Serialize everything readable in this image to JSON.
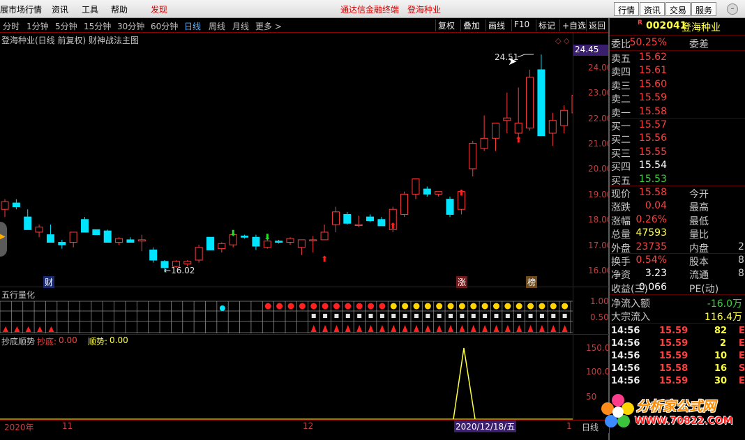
{
  "menubar": {
    "items": [
      "展市场行情",
      "资讯",
      "工具",
      "帮助"
    ],
    "discover": "发现",
    "center_title": "通达信金融终端",
    "center_stock": "登海种业",
    "right_buttons": [
      "行情",
      "资讯",
      "交易",
      "服务"
    ]
  },
  "periods": [
    "分时",
    "1分钟",
    "5分钟",
    "15分钟",
    "30分钟",
    "60分钟",
    "日线",
    "周线",
    "月线",
    "更多 >"
  ],
  "toolbar": [
    "复权",
    "叠加",
    "画线",
    "F10",
    "标记",
    "+自选",
    "返回"
  ],
  "chart_title": "登海种业(日线 前复权) 财神战法主图",
  "price_axis": [
    "24.00",
    "23.00",
    "22.00",
    "21.00",
    "20.00",
    "19.00",
    "18.00",
    "17.00",
    "16.00"
  ],
  "current_price_tag": "24.45",
  "high_label": "24.51",
  "low_label": "16.02",
  "markers": {
    "cai": "财",
    "zhang": "涨",
    "bang": "榜"
  },
  "indicator1": {
    "title": "五行量化",
    "axis": [
      "1.00",
      "0.50"
    ]
  },
  "indicator2": {
    "title": "抄底顺势",
    "chaodi_label": "抄底:",
    "chaodi_value": "0.00",
    "shunshi_label": "顺势:",
    "shunshi_value": "0.00",
    "axis": [
      "150.0",
      "100.0",
      "50"
    ]
  },
  "date_axis": {
    "year": "2020年",
    "m11": "11",
    "m12": "12",
    "cursor": "2020/12/18/五",
    "m1": "1",
    "period": "日线"
  },
  "quote": {
    "code": "002041",
    "name": "登海种业",
    "weibi_label": "委比",
    "weibi_value": "50.25%",
    "weicha_label": "委差",
    "asks": [
      {
        "label": "卖五",
        "price": "15.62"
      },
      {
        "label": "卖四",
        "price": "15.61"
      },
      {
        "label": "卖三",
        "price": "15.60"
      },
      {
        "label": "卖二",
        "price": "15.59"
      },
      {
        "label": "卖一",
        "price": "15.58"
      }
    ],
    "bids": [
      {
        "label": "买一",
        "price": "15.57"
      },
      {
        "label": "买二",
        "price": "15.56"
      },
      {
        "label": "买三",
        "price": "15.55"
      },
      {
        "label": "买四",
        "price": "15.54"
      },
      {
        "label": "买五",
        "price": "15.53"
      }
    ],
    "stats": [
      {
        "label": "现价",
        "value": "15.58",
        "label2": "今开"
      },
      {
        "label": "涨跌",
        "value": "0.04",
        "label2": "最高"
      },
      {
        "label": "涨幅",
        "value": "0.26%",
        "label2": "最低"
      },
      {
        "label": "总量",
        "value": "47593",
        "label2": "量比"
      },
      {
        "label": "外盘",
        "value": "23735",
        "label2": "内盘",
        "value2": "2"
      }
    ],
    "stats2": [
      {
        "label": "换手",
        "value": "0.54%",
        "label2": "股本",
        "value2": "8"
      },
      {
        "label": "净资",
        "value": "3.23",
        "label2": "流通",
        "value2": "8"
      },
      {
        "label": "收益(三)",
        "value": "0.066",
        "label2": "PE(动)"
      }
    ],
    "flow": [
      {
        "label": "净流入额",
        "value": "-16.0万"
      },
      {
        "label": "大宗流入",
        "value": "116.4万"
      }
    ],
    "ticks": [
      {
        "time": "14:56",
        "price": "15.59",
        "vol": "82",
        "bs": "E"
      },
      {
        "time": "14:56",
        "price": "15.59",
        "vol": "2",
        "bs": "E"
      },
      {
        "time": "14:56",
        "price": "15.59",
        "vol": "10",
        "bs": "E"
      },
      {
        "time": "14:56",
        "price": "15.58",
        "vol": "16",
        "bs": "S"
      },
      {
        "time": "14:56",
        "price": "15.59",
        "vol": "30",
        "bs": "E"
      }
    ]
  },
  "watermark": {
    "title": "分析家公式网",
    "url": "WWW.70822.COM"
  },
  "colors": {
    "up": "#ff3c3c",
    "down": "#00e5ff",
    "axis": "#8b0000",
    "bg": "#000000"
  }
}
